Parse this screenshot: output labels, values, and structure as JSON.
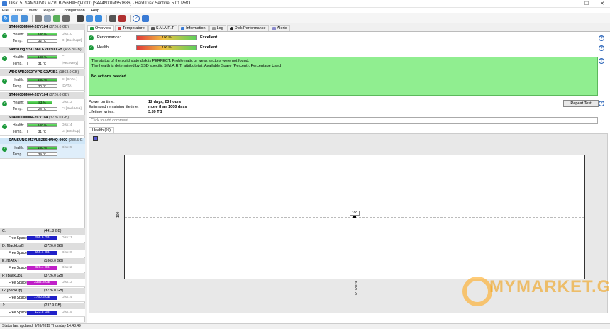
{
  "window": {
    "title": "Disk: 5, SAMSUNG MZVLB256HAHQ-0000 [S444NX0M350836] - Hard Disk Sentinel 5.01 PRO",
    "controls": [
      "—",
      "☐",
      "✕"
    ]
  },
  "menu": [
    "File",
    "Disk",
    "View",
    "Report",
    "Configuration",
    "Help"
  ],
  "disks": [
    {
      "name": "ST4000DM004-2CV104",
      "capacity": "(3726.0 GB)",
      "health": "100 %",
      "health_value": 100,
      "temp": "32 °C",
      "side1": "Disk: 0",
      "side2": "D: [BackUp2]"
    },
    {
      "name": "Samsung SSD 860 EVO 500GB",
      "capacity": "(465.8 GB)",
      "health": "100 %",
      "health_value": 100,
      "temp": "31 °C",
      "side1": "C:",
      "side2": "[Recovery]"
    },
    {
      "name": "WDC WD2002FYPS-02W3B1",
      "capacity": "(1863.0 GB)",
      "health": "100 %",
      "health_value": 100,
      "temp": "30 °C",
      "side1": "E: [DATA ]",
      "side2": "[DATA]"
    },
    {
      "name": "ST4000DM004-2CV104",
      "capacity": "(3726.0 GB)",
      "health": "83 %",
      "health_value": 83,
      "temp": "28 °C",
      "side1": "Disk: 3",
      "side2": "F: [BackUp1]"
    },
    {
      "name": "ST4000DM004-2CV104",
      "capacity": "(3726.0 GB)",
      "health": "100 %",
      "health_value": 100,
      "temp": "31 °C",
      "side1": "Disk: 4",
      "side2": "G: [BackUp]"
    },
    {
      "name": "SAMSUNG MZVLB256HAHQ-0000",
      "capacity": "(238.5 G",
      "health": "100 %",
      "health_value": 100,
      "temp": "39 °C",
      "side1": "Disk: 5",
      "side2": "J:"
    }
  ],
  "labels": {
    "health": "Health:",
    "temp": "Temp.:",
    "free_space": "Free Space"
  },
  "volumes": [
    {
      "name": "C:",
      "capacity": "(441.8 GB)",
      "free": "295.9 GB",
      "disk": "Disk: 1",
      "color": "blue"
    },
    {
      "name": "D: [BackUp2]",
      "capacity": "(3726.0 GB)",
      "free": "559.1 GB",
      "disk": "Disk: 0",
      "color": "blue"
    },
    {
      "name": "E: [DATA ]",
      "capacity": "(1863.0 GB)",
      "free": "828.4 GB",
      "disk": "Disk: 2",
      "color": "magenta"
    },
    {
      "name": "F: [BackUp1]",
      "capacity": "(3726.0 GB)",
      "free": "3364.3 GB",
      "disk": "Disk: 3",
      "color": "magenta"
    },
    {
      "name": "G: [BackUp]",
      "capacity": "(3726.0 GB)",
      "free": "1760.5 GB",
      "disk": "Disk: 4",
      "color": "blue"
    },
    {
      "name": "J:",
      "capacity": "(237.9 GB)",
      "free": "123.5 GB",
      "disk": "Disk: 5",
      "color": "blue"
    }
  ],
  "status": "Status last updated: 9/26/2019 Thursday 14:43:49",
  "tabs": [
    "Overview",
    "Temperature",
    "S.M.A.R.T.",
    "Information",
    "Log",
    "Disk Performance",
    "Alerts"
  ],
  "overview": {
    "performance_label": "Performance:",
    "performance_value": "100 %",
    "performance_text": "Excellent",
    "health_label": "Health:",
    "health_value": "100 %",
    "health_text": "Excellent",
    "message_line1": "The status of the solid state disk is PERFECT. Problematic or weak sectors were not found.",
    "message_line2": "The health is determined by SSD specific S.M.A.R.T. attribute(s):  Available Spare (Percent), Percentage Used",
    "message_actions": "No actions needed.",
    "power_on_label": "Power on time:",
    "power_on_value": "12 days, 23 hours",
    "remaining_label": "Estimated remaining lifetime:",
    "remaining_value": "more than 1000 days",
    "writes_label": "Lifetime writes:",
    "writes_value": "3.59 TB",
    "repeat_button": "Repeat Test",
    "comment_placeholder": "Click to add comment ...",
    "health_tab": "Health (%)"
  },
  "chart_data": {
    "type": "line",
    "x": [
      "7/27/2019"
    ],
    "values": [
      100
    ],
    "point_label": "100",
    "ytick": "100",
    "xtick": "7/27/2019"
  },
  "watermark": {
    "text": "MYMARKET.GE"
  }
}
